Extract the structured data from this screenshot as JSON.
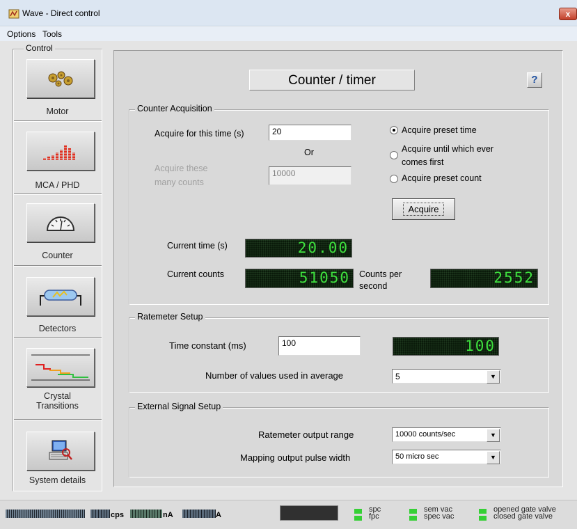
{
  "window": {
    "title": "Wave - Direct control",
    "close_glyph": "x"
  },
  "menu": [
    "Options",
    "Tools"
  ],
  "sidebar": {
    "legend": "Control",
    "items": [
      {
        "label": "Motor",
        "icon": "gears-icon"
      },
      {
        "label": "MCA / PHD",
        "icon": "histogram-icon"
      },
      {
        "label": "Counter",
        "icon": "gauge-icon"
      },
      {
        "label": "Detectors",
        "icon": "detector-icon"
      },
      {
        "label": "Crystal\nTransitions",
        "icon": "transitions-icon"
      },
      {
        "label": "System details",
        "icon": "computer-icon"
      }
    ]
  },
  "main": {
    "title": "Counter / timer",
    "help": "?",
    "acquisition": {
      "legend": "Counter Acquisition",
      "time_label": "Acquire for this time (s)",
      "time_value": "20",
      "or_label": "Or",
      "counts_label_1": "Acquire these",
      "counts_label_2": "many counts",
      "counts_value": "10000",
      "radio_preset_time": "Acquire preset time",
      "radio_whichever_1": "Acquire until which ever",
      "radio_whichever_2": "comes first",
      "radio_preset_count": "Acquire preset count",
      "selected_radio": "preset_time",
      "acquire_button": "Acquire",
      "current_time_label": "Current time (s)",
      "current_time_value": "20.00",
      "current_counts_label": "Current counts",
      "current_counts_value": "51050",
      "cps_label_1": "Counts per",
      "cps_label_2": "second",
      "cps_value": "2552"
    },
    "ratemeter": {
      "legend": "Ratemeter Setup",
      "time_constant_label": "Time constant (ms)",
      "time_constant_value": "100",
      "time_constant_display": "100",
      "values_label": "Number of values used in average",
      "values_selected": "5"
    },
    "external": {
      "legend": "External Signal Setup",
      "range_label": "Ratemeter output range",
      "range_selected": "10000 counts/sec",
      "pulse_label": "Mapping output pulse width",
      "pulse_selected": "50 micro sec"
    }
  },
  "status": {
    "cps_unit": "cps",
    "na_unit": "nA",
    "a_unit": "A",
    "indicators": [
      {
        "top": "spc",
        "bottom": "fpc"
      },
      {
        "top": "sem vac",
        "bottom": "spec vac"
      },
      {
        "top": "opened gate valve",
        "bottom": "closed gate valve"
      }
    ],
    "led_color": "#35d035"
  }
}
